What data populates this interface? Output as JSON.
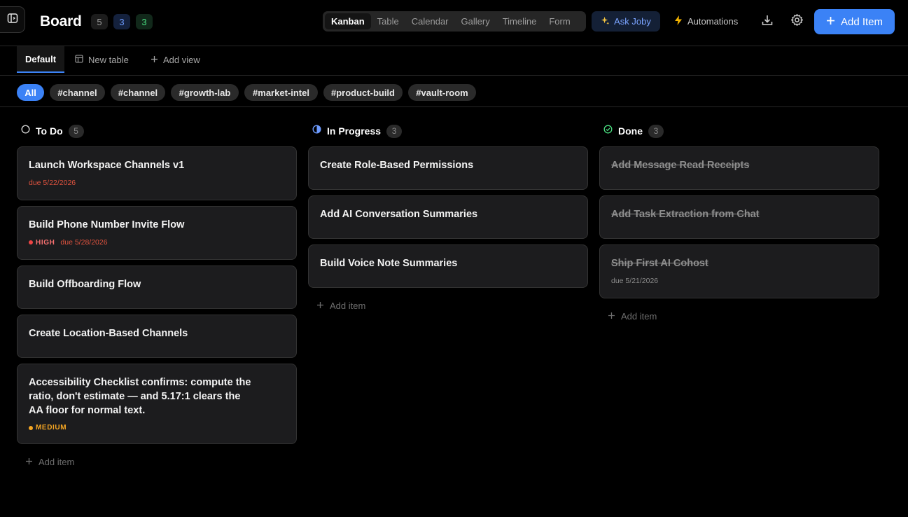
{
  "header": {
    "title": "Board",
    "counts": {
      "todo": "5",
      "in_progress": "3",
      "done": "3"
    },
    "views": [
      "Kanban",
      "Table",
      "Calendar",
      "Gallery",
      "Timeline",
      "Form"
    ],
    "active_view": "Kanban",
    "ask_joby": "Ask Joby",
    "automations": "Automations",
    "add_item": "Add Item"
  },
  "page_tabs": {
    "default": "Default",
    "new_table": "New table",
    "add_view": "Add view"
  },
  "filters": [
    "All",
    "#channel",
    "#channel",
    "#growth-lab",
    "#market-intel",
    "#product-build",
    "#vault-room"
  ],
  "columns": [
    {
      "title": "To Do",
      "count": "5",
      "add_label": "Add item",
      "cards": [
        {
          "title": "Launch Workspace Channels v1",
          "due": "due 5/22/2026"
        },
        {
          "title": "Build Phone Number Invite Flow",
          "priority": "HIGH",
          "due": "due 5/28/2026"
        },
        {
          "title": "Build Offboarding Flow"
        },
        {
          "title": "Create Location-Based Channels"
        },
        {
          "title": "Accessibility Checklist confirms: compute the ratio, don't estimate — and 5.17:1 clears the AA floor for normal text.",
          "priority": "MEDIUM"
        }
      ]
    },
    {
      "title": "In Progress",
      "count": "3",
      "add_label": "Add item",
      "cards": [
        {
          "title": "Create Role-Based Permissions"
        },
        {
          "title": "Add AI Conversation Summaries"
        },
        {
          "title": "Build Voice Note Summaries"
        }
      ]
    },
    {
      "title": "Done",
      "count": "3",
      "add_label": "Add item",
      "cards": [
        {
          "title": "Add Message Read Receipts"
        },
        {
          "title": "Add Task Extraction from Chat"
        },
        {
          "title": "Ship First AI Cohost",
          "due": "due 5/21/2026"
        }
      ]
    }
  ],
  "colors": {
    "accent": "#3b82f6",
    "priority_high": "#ef4444",
    "priority_medium": "#f5a623",
    "done_check": "#4ade80"
  }
}
